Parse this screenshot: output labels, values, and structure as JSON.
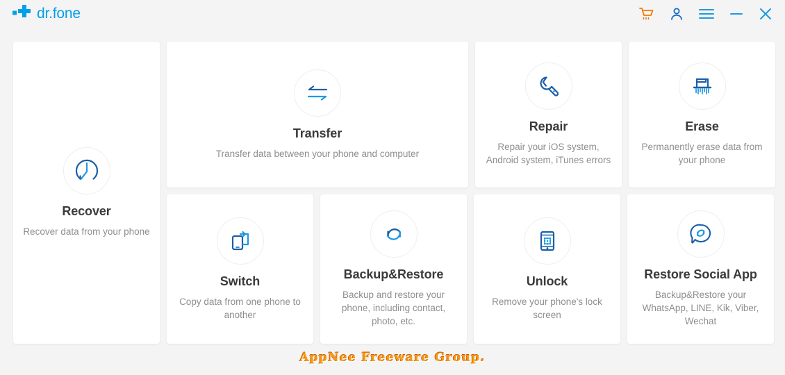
{
  "app": {
    "brand_name": "dr.fone",
    "logo_icon": "plus-cross-logo"
  },
  "titlebar": {
    "actions": [
      {
        "name": "cart-icon",
        "label": "Shopping Cart",
        "color": "#f07800"
      },
      {
        "name": "account-icon",
        "label": "Account",
        "color": "#1769c8"
      },
      {
        "name": "menu-icon",
        "label": "Menu",
        "color": "#1e9ae0"
      },
      {
        "name": "minimize-icon",
        "label": "Minimize",
        "color": "#1e9ae0"
      },
      {
        "name": "close-icon",
        "label": "Close",
        "color": "#1e9ae0"
      }
    ]
  },
  "colors": {
    "brand_blue": "#00a0e9",
    "icon_dark_blue": "#1b5fa8",
    "icon_light_blue": "#1e9ae0",
    "accent_orange": "#f07800",
    "page_background": "#f4f4f4",
    "card_background": "#ffffff",
    "title_text": "#3a3a3a",
    "desc_text": "#8e8e8e"
  },
  "features": {
    "recover": {
      "icon": "clock-recover-icon",
      "title": "Recover",
      "desc": "Recover data from your phone"
    },
    "transfer": {
      "icon": "two-way-arrows-icon",
      "title": "Transfer",
      "desc": "Transfer data between your phone and computer"
    },
    "repair": {
      "icon": "wrench-icon",
      "title": "Repair",
      "desc": "Repair your iOS system, Android system, iTunes errors"
    },
    "erase": {
      "icon": "shredder-icon",
      "title": "Erase",
      "desc": "Permanently erase data from your phone"
    },
    "switch": {
      "icon": "phone-switch-icon",
      "title": "Switch",
      "desc": "Copy data from one phone to another"
    },
    "backup_restore": {
      "icon": "circular-refresh-icon",
      "title": "Backup&Restore",
      "desc": "Backup and restore your phone, including contact, photo, etc."
    },
    "unlock": {
      "icon": "phone-lock-pattern-icon",
      "title": "Unlock",
      "desc": "Remove your phone's lock screen"
    },
    "restore_social_app": {
      "icon": "chat-bubble-refresh-icon",
      "title": "Restore Social App",
      "desc": "Backup&Restore your WhatsApp, LINE, Kik, Viber, Wechat"
    }
  },
  "watermark": {
    "text": "AppNee Freeware Group."
  }
}
